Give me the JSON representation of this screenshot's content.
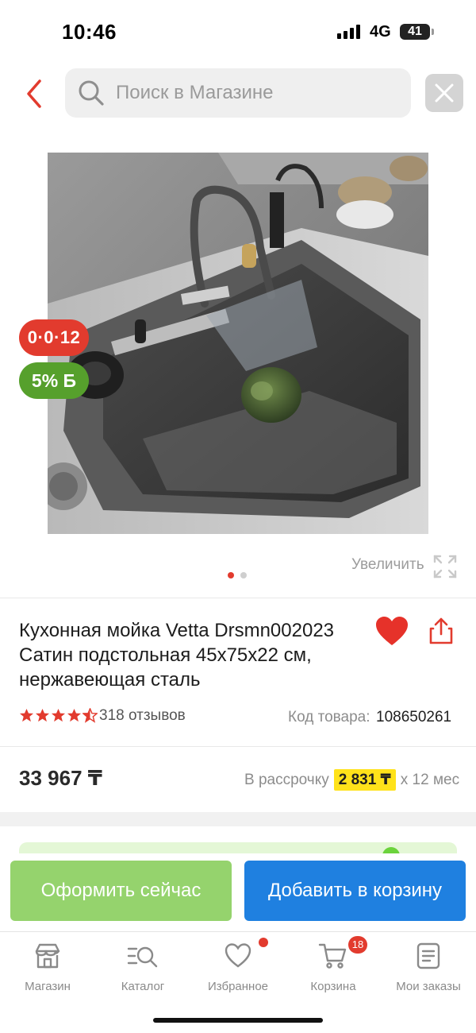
{
  "status_bar": {
    "time": "10:46",
    "network": "4G",
    "battery": "41"
  },
  "header": {
    "back_icon": "chevron-left-icon",
    "search_placeholder": "Поиск в Магазине",
    "close_icon": "close-icon"
  },
  "gallery": {
    "installment_badge": "0·0·12",
    "bonus_badge": "5% Б",
    "zoom_label": "Увеличить",
    "slide_count": 2,
    "active_slide": 1
  },
  "product": {
    "title": "Кухонная мойка Vetta Drsmn002023\nСатин подстольная 45x75x22 см,\nнержавеющая сталь",
    "rating": 4.5,
    "reviews": "318 отзывов",
    "sku_label": "Код товара:",
    "sku_value": "108650261",
    "favorited": true
  },
  "pricing": {
    "price": "33 967 ₸",
    "installment_prefix": "В рассрочку",
    "installment_amount": "2 831 ₸",
    "installment_suffix": "x 12 мес"
  },
  "actions": {
    "checkout": "Оформить сейчас",
    "add_to_cart": "Добавить в корзину"
  },
  "tabbar": {
    "items": [
      {
        "label": "Магазин",
        "icon": "store-icon"
      },
      {
        "label": "Каталог",
        "icon": "catalog-search-icon"
      },
      {
        "label": "Избранное",
        "icon": "heart-icon"
      },
      {
        "label": "Корзина",
        "icon": "cart-icon"
      },
      {
        "label": "Мои заказы",
        "icon": "orders-icon"
      }
    ],
    "cart_count": "18"
  },
  "colors": {
    "accent_red": "#e23b2e",
    "bonus_green": "#56a02c",
    "checkout_green": "#95d36d",
    "cart_blue": "#1f80e0",
    "installment_yellow": "#ffe21a"
  }
}
